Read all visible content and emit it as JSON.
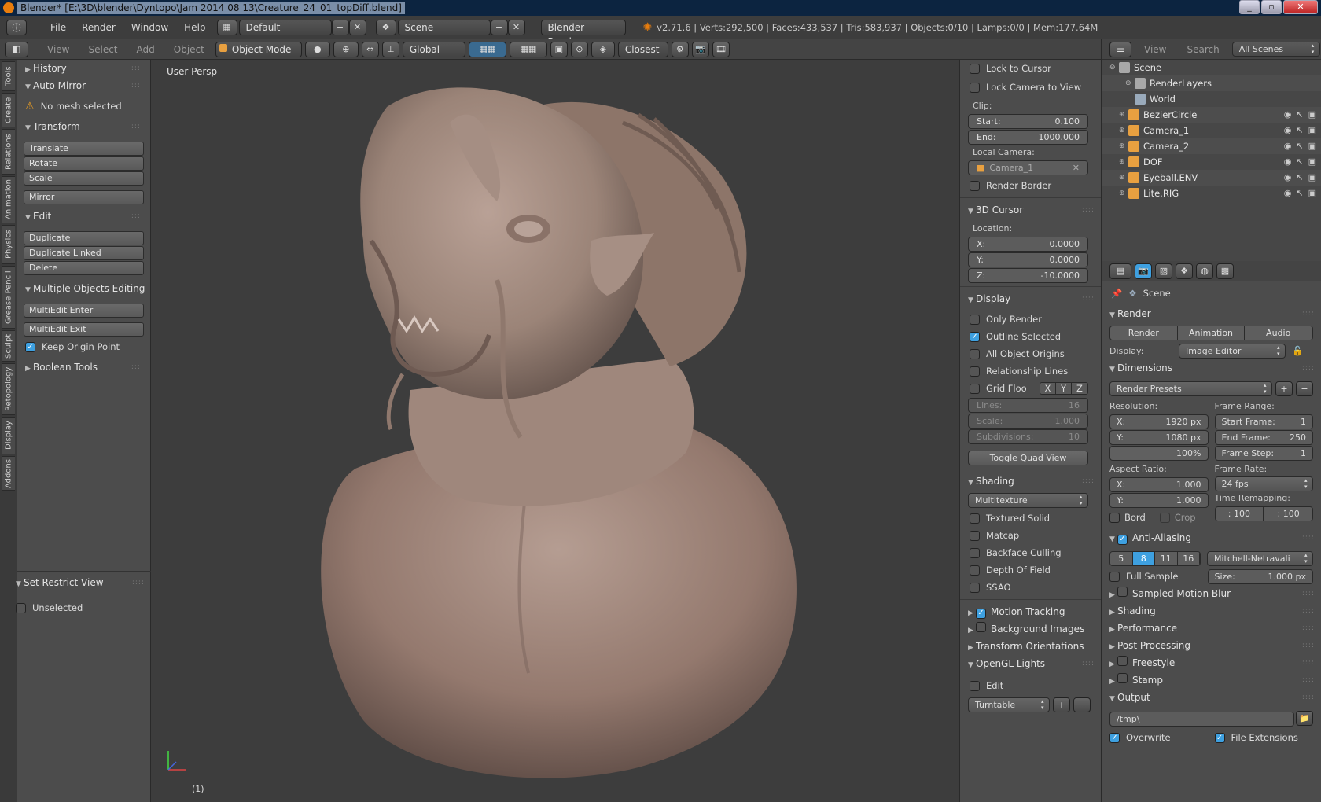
{
  "titlebar": {
    "title": "Blender* [E:\\3D\\blender\\Dyntopo\\Jam 2014 08 13\\Creature_24_01_topDiff.blend]"
  },
  "window_buttons": [
    "_",
    "▫",
    "✕"
  ],
  "menubar": {
    "items": [
      "File",
      "Render",
      "Window",
      "Help"
    ],
    "layout": "Default",
    "scene": "Scene",
    "engine": "Blender Render",
    "stats": "v2.71.6 | Verts:292,500 | Faces:433,537 | Tris:583,937 | Objects:0/10 | Lamps:0/0 | Mem:177.64M"
  },
  "header3d": {
    "menus": [
      "View",
      "Select",
      "Add",
      "Object"
    ],
    "mode": "Object Mode",
    "orientation": "Global",
    "snap": "Closest"
  },
  "toolshelf_tabs": [
    "Tools",
    "Create",
    "Relations",
    "Animation",
    "Physics",
    "Grease Pencil",
    "Sculpt",
    "Retopology",
    "Display",
    "Addons"
  ],
  "left_panel": {
    "history": "History",
    "auto_mirror": "Auto Mirror",
    "no_mesh": "No mesh selected",
    "transform": "Transform",
    "transform_buttons": [
      "Translate",
      "Rotate",
      "Scale"
    ],
    "mirror": "Mirror",
    "edit": "Edit",
    "edit_buttons": [
      "Duplicate",
      "Duplicate Linked",
      "Delete"
    ],
    "multi": "Multiple Objects Editing",
    "multi_buttons": [
      "MultiEdit Enter",
      "MultiEdit Exit"
    ],
    "keep_origin": "Keep Origin Point",
    "boolean": "Boolean Tools",
    "restrict": "Set Restrict View",
    "unselected": "Unselected"
  },
  "viewport": {
    "label": "User Persp",
    "frame": "(1)"
  },
  "npanel": {
    "lock_cursor": "Lock to Cursor",
    "lock_camera": "Lock Camera to View",
    "clip": "Clip:",
    "clip_start_label": "Start:",
    "clip_start": "0.100",
    "clip_end_label": "End:",
    "clip_end": "1000.000",
    "local_camera": "Local Camera:",
    "camera": "Camera_1",
    "render_border": "Render Border",
    "cursor": "3D Cursor",
    "location": "Location:",
    "x_label": "X:",
    "x": "0.0000",
    "y_label": "Y:",
    "y": "0.0000",
    "z_label": "Z:",
    "z": "-10.0000",
    "display": "Display",
    "only_render": "Only Render",
    "outline_selected": "Outline Selected",
    "all_origins": "All Object Origins",
    "rel_lines": "Relationship Lines",
    "grid_floor": "Grid Floo",
    "axes": [
      "X",
      "Y",
      "Z"
    ],
    "lines_label": "Lines:",
    "lines": "16",
    "scale_label": "Scale:",
    "scale": "1.000",
    "subdiv_label": "Subdivisions:",
    "subdiv": "10",
    "toggle_quad": "Toggle Quad View",
    "shading": "Shading",
    "shading_mode": "Multitexture",
    "textured_solid": "Textured Solid",
    "matcap": "Matcap",
    "backface": "Backface Culling",
    "dof": "Depth Of Field",
    "ssao": "SSAO",
    "motion": "Motion Tracking",
    "background": "Background Images",
    "transform_or": "Transform Orientations",
    "opengl": "OpenGL Lights",
    "edit": "Edit",
    "turntable": "Turntable"
  },
  "outliner": {
    "menus": [
      "View",
      "Search"
    ],
    "filter": "All Scenes",
    "rows": [
      {
        "name": "Scene",
        "color": "#a8a8a8"
      },
      {
        "name": "RenderLayers",
        "color": "#a8a8a8"
      },
      {
        "name": "World",
        "color": "#9ab"
      },
      {
        "name": "BezierCircle",
        "color": "#e8a040"
      },
      {
        "name": "Camera_1",
        "color": "#e8a040"
      },
      {
        "name": "Camera_2",
        "color": "#e8a040"
      },
      {
        "name": "DOF",
        "color": "#e8a040"
      },
      {
        "name": "Eyeball.ENV",
        "color": "#e8a040"
      },
      {
        "name": "Lite.RIG",
        "color": "#e8a040"
      }
    ]
  },
  "properties": {
    "scene": "Scene",
    "render": "Render",
    "render_tabs": [
      "Render",
      "Animation",
      "Audio"
    ],
    "display_label": "Display:",
    "display": "Image Editor",
    "dimensions": "Dimensions",
    "presets": "Render Presets",
    "resolution": "Resolution:",
    "res_x": "1920 px",
    "res_y": "1080 px",
    "res_pct": "100%",
    "frame_range": "Frame Range:",
    "start_frame_label": "Start Frame:",
    "start_frame": "1",
    "end_frame_label": "End Frame:",
    "end_frame": "250",
    "frame_step_label": "Frame Step:",
    "frame_step": "1",
    "aspect": "Aspect Ratio:",
    "aspect_x": "1.000",
    "aspect_y": "1.000",
    "frame_rate": "Frame Rate:",
    "fps": "24 fps",
    "time_remap": "Time Remapping:",
    "remap_old": ": 100",
    "remap_new": ": 100",
    "bord": "Bord",
    "crop": "Crop",
    "aa": "Anti-Aliasing",
    "aa_samples": [
      "5",
      "8",
      "11",
      "16"
    ],
    "filter": "Mitchell-Netravali",
    "full_sample": "Full Sample",
    "size_label": "Size:",
    "size": "1.000 px",
    "collapsed": [
      "Sampled Motion Blur",
      "Shading",
      "Performance",
      "Post Processing",
      "Freestyle",
      "Stamp"
    ],
    "output": "Output",
    "path": "/tmp\\",
    "overwrite": "Overwrite",
    "file_ext": "File Extensions"
  },
  "colors": {
    "accent": "#3ea0e0",
    "titlebar": "#0c2440",
    "sculpt": "#9b8478"
  }
}
